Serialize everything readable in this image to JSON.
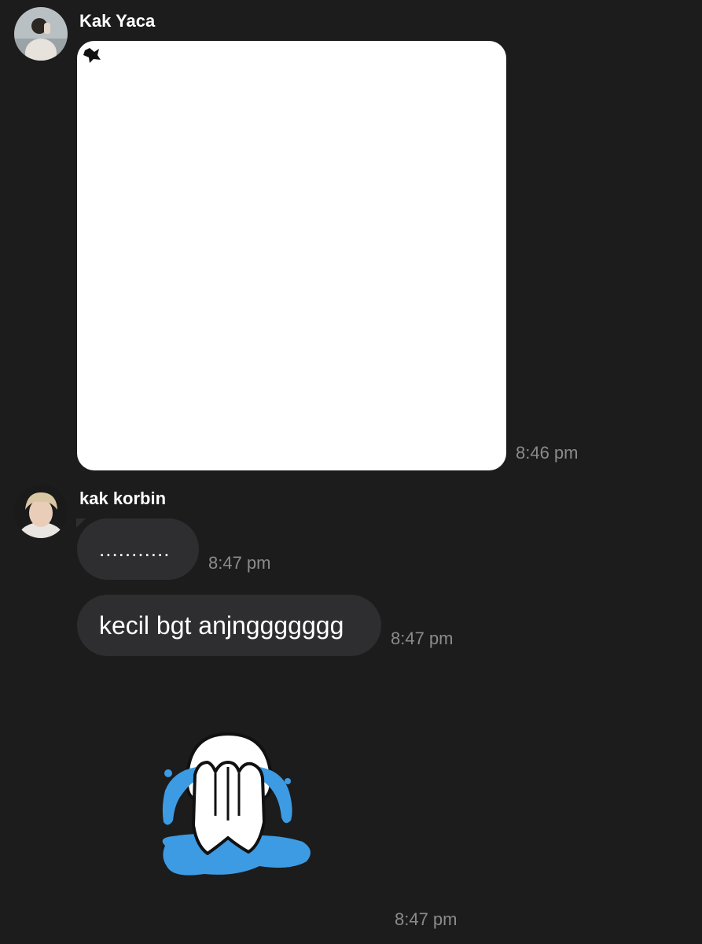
{
  "messages": [
    {
      "sender": "Kak Yaca",
      "avatar": "avatar-kak-yaca",
      "type": "image",
      "time": "8:46 pm"
    },
    {
      "sender": "kak korbin",
      "avatar": "avatar-kak-korbin",
      "type": "text",
      "text": "...........",
      "time": "8:47 pm"
    },
    {
      "type": "text",
      "text": "kecil bgt anjnggggggg",
      "time": "8:47 pm"
    },
    {
      "type": "sticker",
      "sticker": "crying-ghost-sticker",
      "time": "8:47 pm"
    }
  ],
  "colors": {
    "background": "#1c1c1d",
    "bubble": "#2e2e30",
    "timestamp": "#8b8b8d",
    "sticker_tears": "#3d9be3"
  }
}
